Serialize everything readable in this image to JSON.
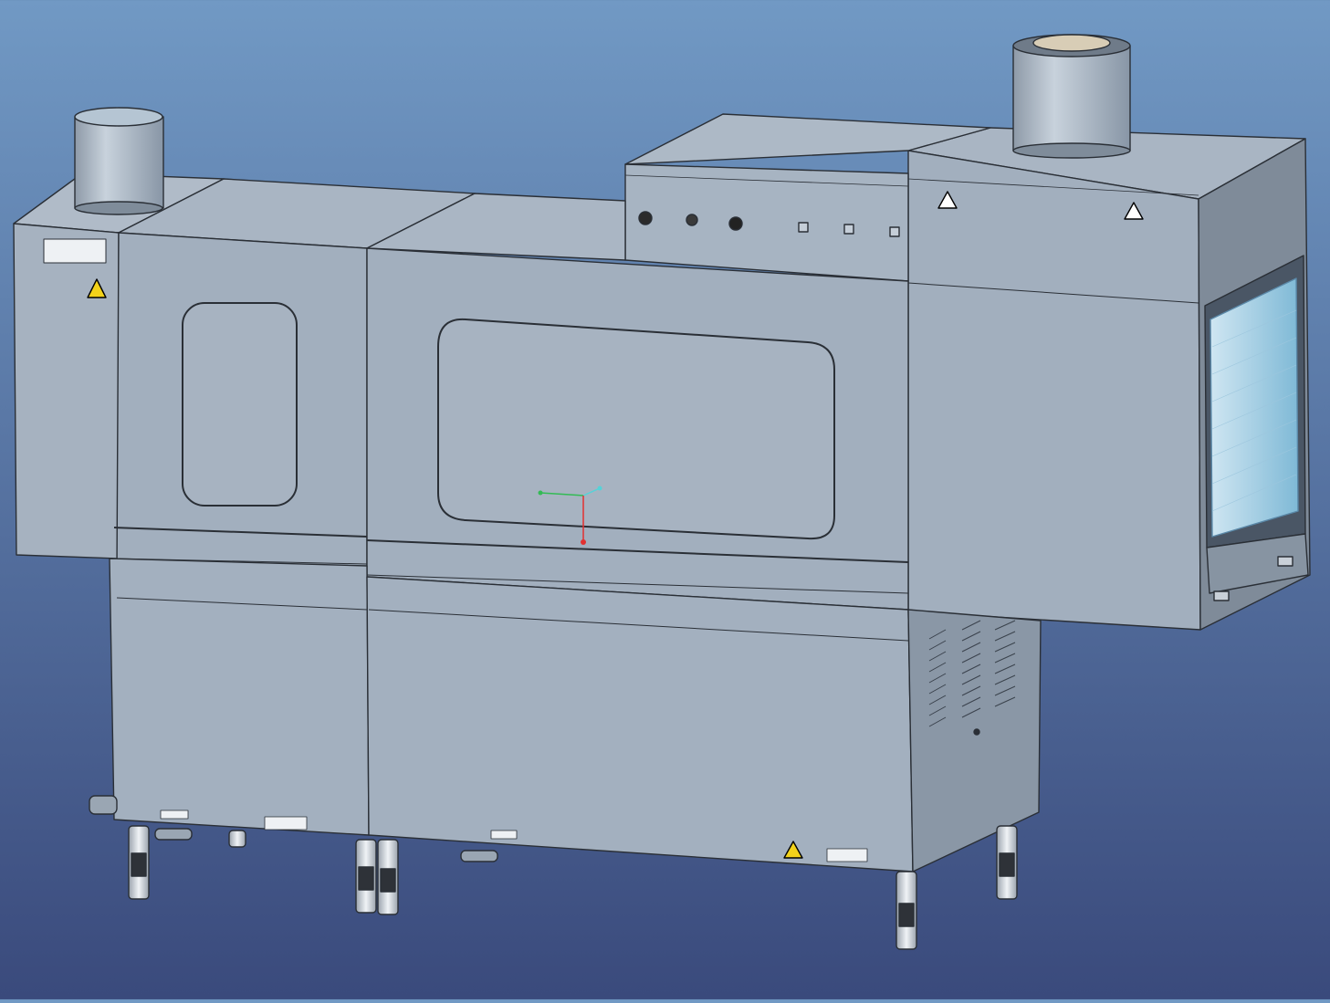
{
  "view": {
    "background_top": "#7199c4",
    "background_bottom": "#3a4a7c",
    "model_color": "#a2afbe",
    "edge_color": "#2a2f36"
  },
  "scene": {
    "subject": "conveyor-dishwasher-3d-model",
    "components": [
      "left-exhaust-duct",
      "right-exhaust-duct",
      "left-end-module",
      "prewash-module",
      "main-wash-module",
      "control-panel-box",
      "drying-tunnel-module",
      "exit-opening",
      "pump-compartment",
      "support-legs"
    ]
  },
  "control_panel": {
    "controls": [
      "indicator-lamp",
      "button",
      "rotary-switch",
      "switch-1",
      "switch-2",
      "switch-3"
    ]
  },
  "axis_triad": {
    "x_color": "#55d3d8",
    "y_color": "#33bb55",
    "z_color": "#e23030"
  }
}
